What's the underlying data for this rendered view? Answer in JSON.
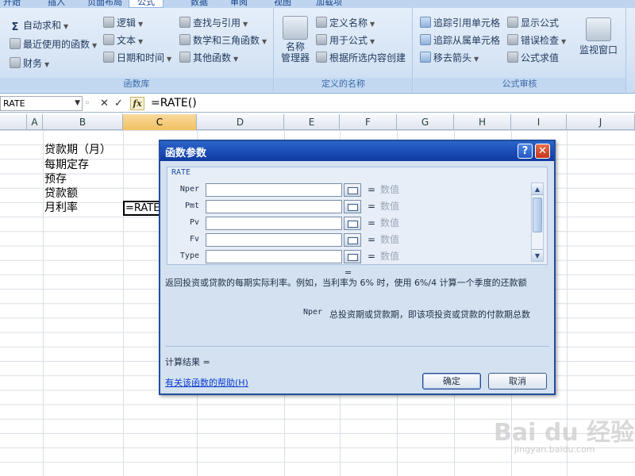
{
  "ribbon_tabs": [
    "开始",
    "插入",
    "页面布局",
    "公式",
    "数据",
    "审阅",
    "视图",
    "加载项"
  ],
  "ribbon": {
    "library": {
      "label": "函数库",
      "items": {
        "autosum": "自动求和",
        "recent": "最近使用的函数",
        "finance": "财务",
        "logic": "逻辑",
        "text": "文本",
        "datetime": "日期和时间",
        "lookup": "查找与引用",
        "math": "数学和三角函数",
        "other": "其他函数"
      }
    },
    "names": {
      "label": "定义的名称",
      "manager": "名称\n管理器",
      "define": "定义名称",
      "use": "用于公式",
      "create": "根据所选内容创建"
    },
    "audit": {
      "label": "公式审核",
      "trace_prec": "追踪引用单元格",
      "trace_dep": "追踪从属单元格",
      "remove": "移去箭头",
      "show": "显示公式",
      "errcheck": "错误检查",
      "eval": "公式求值",
      "watch": "监视窗口"
    }
  },
  "formula_bar": {
    "name_box": "RATE",
    "cancel": "✕",
    "enter": "✓",
    "fx": "fx",
    "formula": "=RATE()"
  },
  "columns": [
    "A",
    "B",
    "C",
    "D",
    "E",
    "F",
    "G",
    "H",
    "I",
    "J"
  ],
  "cells": {
    "b1": "贷款期（月）",
    "b2": "每期定存",
    "b3": "预存",
    "b4": "贷款额",
    "b5": "月利率",
    "c5": "=RATE"
  },
  "dialog": {
    "title": "函数参数",
    "help_btn": "?",
    "close_btn": "✕",
    "func_name": "RATE",
    "params": [
      {
        "name": "Nper",
        "value": "数值"
      },
      {
        "name": "Pmt",
        "value": "数值"
      },
      {
        "name": "Pv",
        "value": "数值"
      },
      {
        "name": "Fv",
        "value": "数值"
      },
      {
        "name": "Type",
        "value": "数值"
      }
    ],
    "eq": "=",
    "result_eq": "=",
    "description": "返回投资或贷款的每期实际利率。例如，当利率为 6% 时，使用 6%/4 计算一个季度的还款额",
    "param_desc_name": "Nper",
    "param_desc": "总投资期或贷款期，即该项投资或贷款的付款期总数",
    "calc_result": "计算结果 =",
    "help_link": "有关该函数的帮助(H)",
    "ok": "确定",
    "cancel": "取消"
  },
  "watermark": {
    "main": "Bai du 经验",
    "sub": "jingyan.baidu.com"
  }
}
